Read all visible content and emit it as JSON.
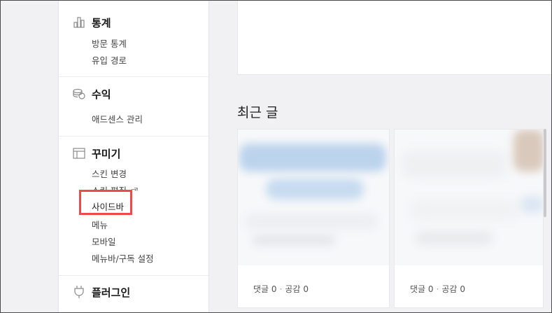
{
  "sidebar": {
    "stats": {
      "title": "통계",
      "icon": "bar-chart-icon",
      "items": [
        "방문 통계",
        "유입 경로"
      ]
    },
    "revenue": {
      "title": "수익",
      "icon": "coins-icon",
      "items": [
        "애드센스 관리"
      ]
    },
    "decorate": {
      "title": "꾸미기",
      "icon": "layout-icon",
      "items": [
        "스킨 변경",
        "스킨 편집",
        "사이드바",
        "메뉴",
        "모바일",
        "메뉴바/구독 설정"
      ]
    },
    "plugin": {
      "title": "플러그인",
      "icon": "plug-icon"
    }
  },
  "highlight_color": "#ef4a4a",
  "main": {
    "recent_title": "최근 글",
    "cards": [
      {
        "comments_label": "댓글",
        "comments": "0",
        "likes_label": "공감",
        "likes": "0"
      },
      {
        "comments_label": "댓글",
        "comments": "0",
        "likes_label": "공감",
        "likes": "0"
      }
    ]
  }
}
